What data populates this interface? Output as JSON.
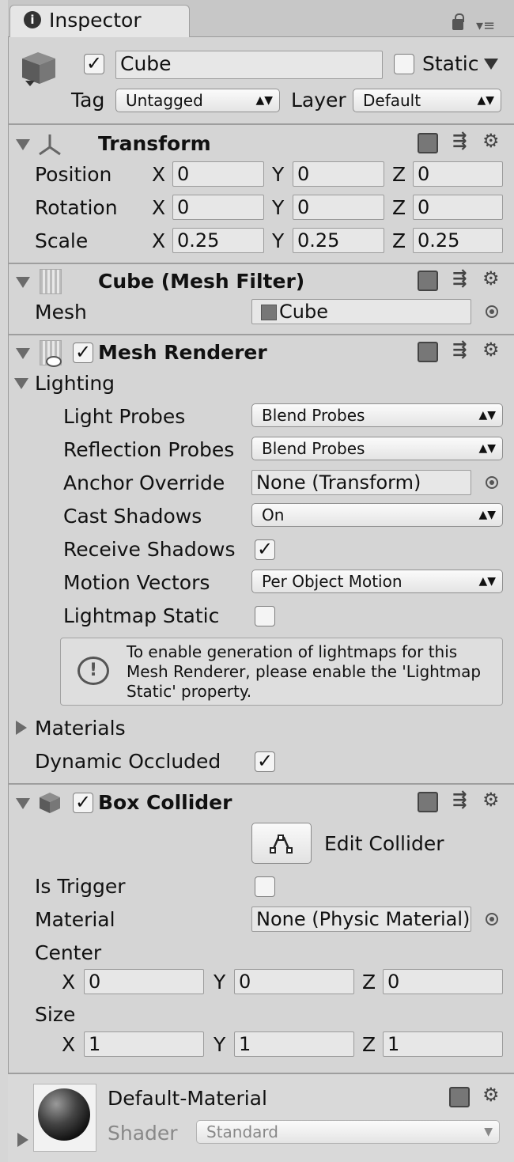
{
  "window": {
    "tab_title": "Inspector"
  },
  "gameobject": {
    "name": "Cube",
    "active": true,
    "static_label": "Static",
    "static_checked": false,
    "tag_label": "Tag",
    "tag_value": "Untagged",
    "layer_label": "Layer",
    "layer_value": "Default"
  },
  "transform": {
    "title": "Transform",
    "rows": [
      {
        "label": "Position",
        "x": "0",
        "y": "0",
        "z": "0"
      },
      {
        "label": "Rotation",
        "x": "0",
        "y": "0",
        "z": "0"
      },
      {
        "label": "Scale",
        "x": "0.25",
        "y": "0.25",
        "z": "0.25"
      }
    ],
    "axis_x": "X",
    "axis_y": "Y",
    "axis_z": "Z"
  },
  "mesh_filter": {
    "title": "Cube (Mesh Filter)",
    "mesh_label": "Mesh",
    "mesh_value": "Cube"
  },
  "mesh_renderer": {
    "title": "Mesh Renderer",
    "lighting_label": "Lighting",
    "light_probes_label": "Light Probes",
    "light_probes_value": "Blend Probes",
    "reflection_probes_label": "Reflection Probes",
    "reflection_probes_value": "Blend Probes",
    "anchor_override_label": "Anchor Override",
    "anchor_override_value": "None (Transform)",
    "cast_shadows_label": "Cast Shadows",
    "cast_shadows_value": "On",
    "receive_shadows_label": "Receive Shadows",
    "motion_vectors_label": "Motion Vectors",
    "motion_vectors_value": "Per Object Motion",
    "lightmap_static_label": "Lightmap Static",
    "info_line1": "To enable generation of lightmaps for this",
    "info_line2": "Mesh Renderer, please enable the 'Lightmap",
    "info_line3": "Static' property.",
    "materials_label": "Materials",
    "dynamic_occluded_label": "Dynamic Occluded"
  },
  "box_collider": {
    "title": "Box Collider",
    "edit_collider_label": "Edit Collider",
    "is_trigger_label": "Is Trigger",
    "material_label": "Material",
    "material_value": "None (Physic Material)",
    "center_label": "Center",
    "center_x": "0",
    "center_y": "0",
    "center_z": "0",
    "size_label": "Size",
    "size_x": "1",
    "size_y": "1",
    "size_z": "1"
  },
  "material": {
    "name": "Default-Material",
    "shader_label": "Shader",
    "shader_value": "Standard"
  },
  "colors": {
    "panel_bg": "#d5d5d5",
    "field_bg": "#e7e7e7",
    "separator": "#9e9e9e"
  }
}
